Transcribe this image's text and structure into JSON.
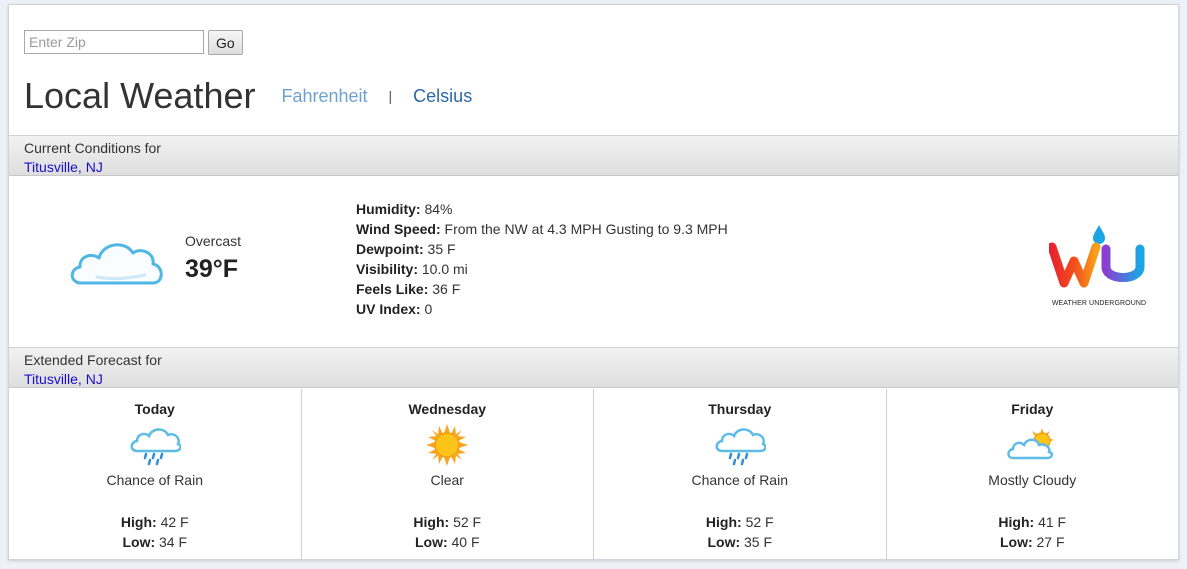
{
  "zip": {
    "placeholder": "Enter Zip",
    "go_label": "Go"
  },
  "title": "Local Weather",
  "units": {
    "fahrenheit": "Fahrenheit",
    "separator": "|",
    "celsius": "Celsius"
  },
  "current": {
    "header": "Current Conditions for",
    "location": "Titusville, NJ",
    "icon": "cloud-icon",
    "condition": "Overcast",
    "temperature": "39°F",
    "details": [
      {
        "label": "Humidity:",
        "value": "84%"
      },
      {
        "label": "Wind Speed:",
        "value": "From the NW at 4.3 MPH Gusting to 9.3 MPH"
      },
      {
        "label": "Dewpoint:",
        "value": "35 F"
      },
      {
        "label": "Visibility:",
        "value": "10.0 mi"
      },
      {
        "label": "Feels Like:",
        "value": "36 F"
      },
      {
        "label": "UV Index:",
        "value": "0"
      }
    ],
    "logo_text": "WEATHER UNDERGROUND",
    "logo_letters": "WU"
  },
  "extended": {
    "header": "Extended Forecast for",
    "location": "Titusville, NJ",
    "high_label": "High:",
    "low_label": "Low:",
    "days": [
      {
        "name": "Today",
        "icon": "rain-icon",
        "condition": "Chance of Rain",
        "high": "42 F",
        "low": "34 F"
      },
      {
        "name": "Wednesday",
        "icon": "sun-icon",
        "condition": "Clear",
        "high": "52 F",
        "low": "40 F"
      },
      {
        "name": "Thursday",
        "icon": "rain-icon",
        "condition": "Chance of Rain",
        "high": "52 F",
        "low": "35 F"
      },
      {
        "name": "Friday",
        "icon": "partly-cloudy-icon",
        "condition": "Mostly Cloudy",
        "high": "41 F",
        "low": "27 F"
      }
    ]
  },
  "colors": {
    "link": "#1a0dcc",
    "fahrenheit": "#6fa1cf",
    "celsius": "#2a68a9"
  }
}
